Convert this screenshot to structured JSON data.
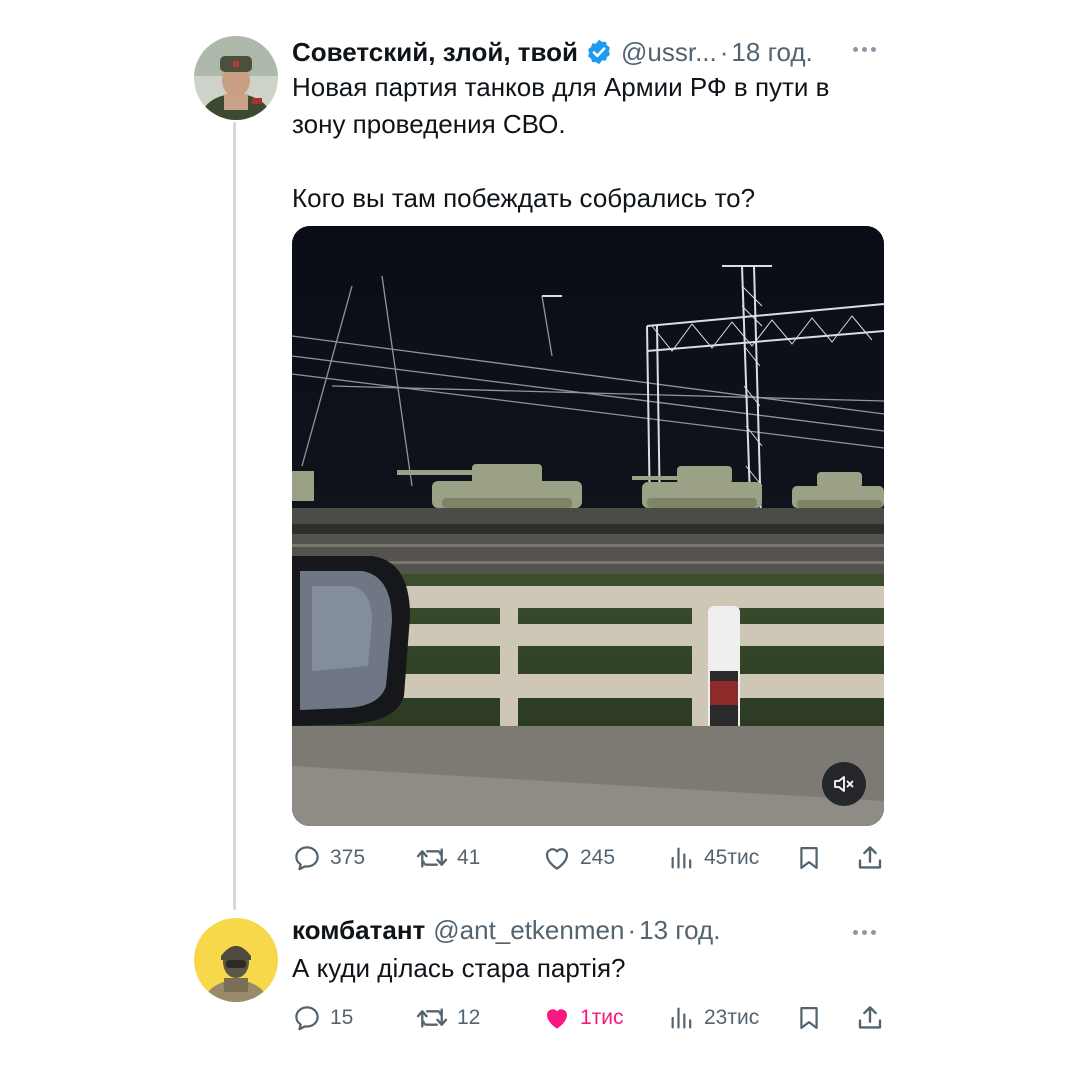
{
  "tweets": [
    {
      "display_name": "Советский, злой, твой",
      "verified": true,
      "handle": "@ussr...",
      "separator": "·",
      "time": "18 год.",
      "text_lines": [
        "Новая партия танков для Армии РФ в пути в",
        "зону проведения СВО."
      ],
      "text_lines_2": [
        "Кого вы там побеждать собрались то?"
      ],
      "media": {
        "type": "video",
        "muted": true,
        "icon": "speaker-muted-icon"
      },
      "stats": {
        "replies": "375",
        "retweets": "41",
        "likes": "245",
        "views": "45тис"
      },
      "liked": false
    },
    {
      "display_name": "комбатант",
      "verified": false,
      "handle": "@ant_etkenmen",
      "separator": "·",
      "time": "13 год.",
      "text": "А куди ділась стара партія?",
      "stats": {
        "replies": "15",
        "retweets": "12",
        "likes": "1тис",
        "views": "23тис"
      },
      "liked": true
    }
  ],
  "colors": {
    "text": "#0f1419",
    "secondary": "#536471",
    "verified": "#1d9bf0",
    "like_active": "#f91880",
    "thread_line": "#cfd9de"
  }
}
